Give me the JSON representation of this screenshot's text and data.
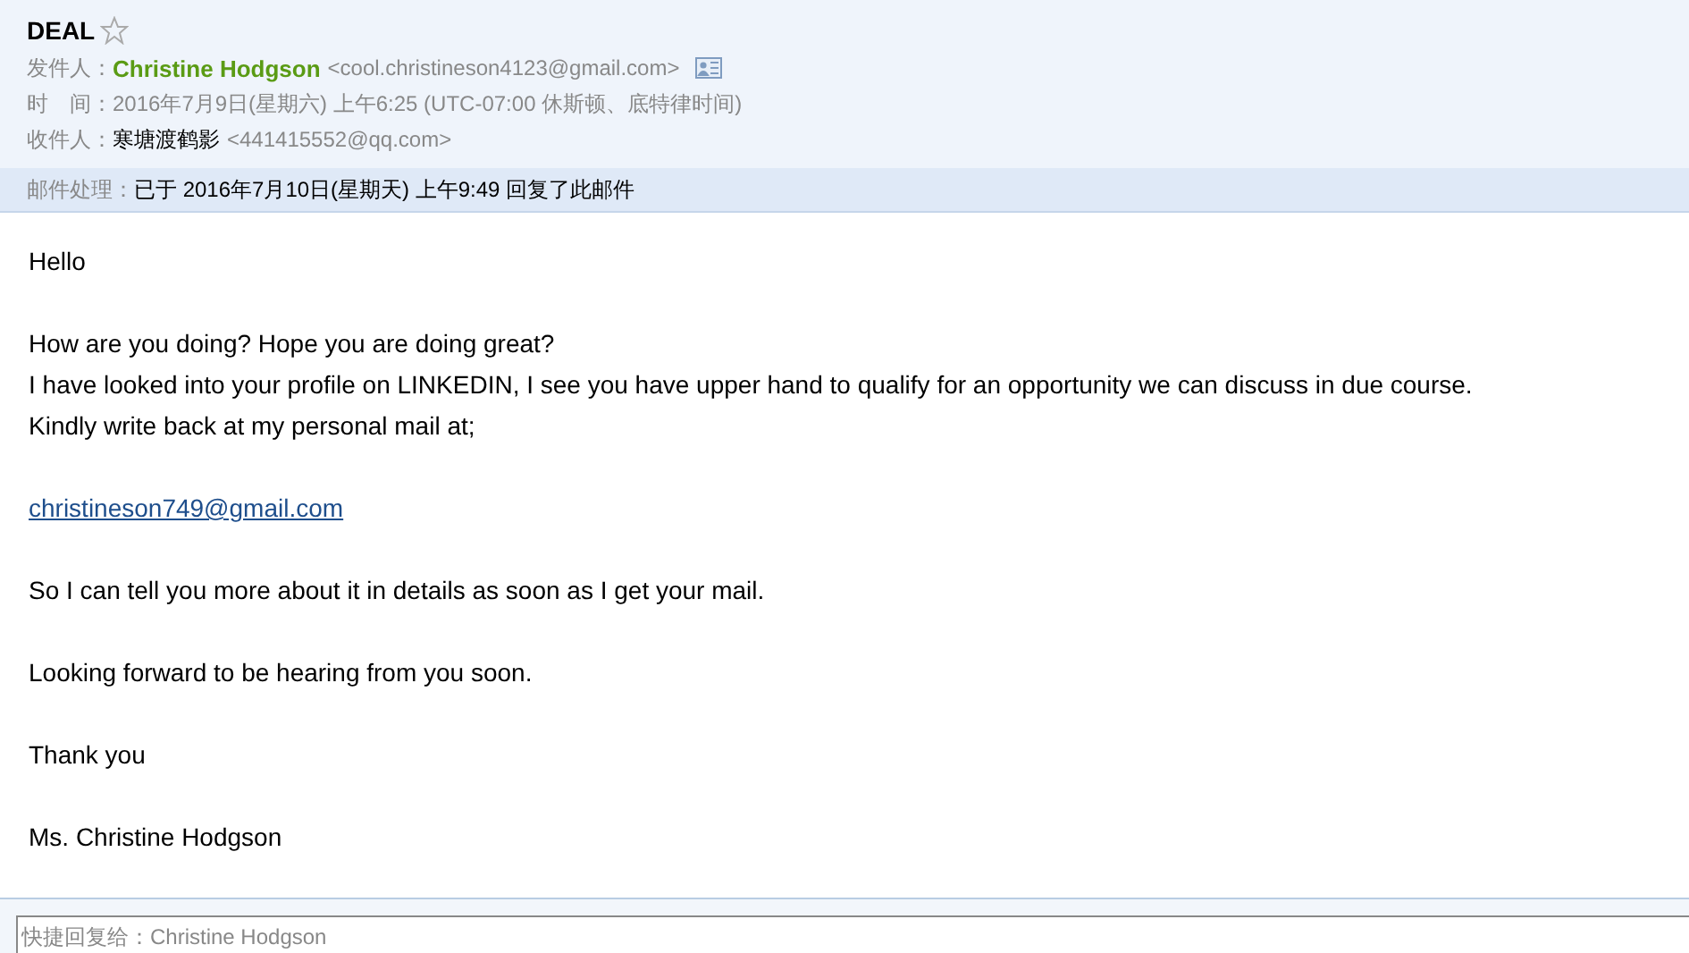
{
  "subject": "DEAL",
  "starred": false,
  "header": [
    {
      "label": "发件人：",
      "name": "Christine Hodgson",
      "address": "<cool.christineson4123@gmail.com>",
      "kind": "sender"
    },
    {
      "label": "时　间：",
      "value": "2016年7月9日(星期六) 上午6:25 (UTC-07:00 休斯顿、底特律时间)",
      "kind": "time"
    },
    {
      "label": "收件人：",
      "name": "寒塘渡鹤影",
      "address": "<441415552@qq.com>",
      "kind": "recipient"
    }
  ],
  "status": {
    "label": "邮件处理：",
    "value": "已于 2016年7月10日(星期天) 上午9:49 回复了此邮件"
  },
  "body": [
    {
      "kind": "text",
      "lines": [
        "Hello"
      ]
    },
    {
      "kind": "text",
      "lines": [
        "How are you doing? Hope you are doing great?",
        "I have looked into your profile on LINKEDIN, I see you have upper hand to qualify for an opportunity we can discuss in due course.",
        "Kindly write back at my personal mail at;"
      ]
    },
    {
      "kind": "link",
      "lines": [
        "christineson749@gmail.com"
      ]
    },
    {
      "kind": "text",
      "lines": [
        "So I can tell you more about it in details as soon as I get your mail."
      ]
    },
    {
      "kind": "text",
      "lines": [
        "Looking forward to be hearing from you soon."
      ]
    },
    {
      "kind": "text",
      "lines": [
        "Thank you"
      ]
    },
    {
      "kind": "text",
      "lines": [
        "Ms. Christine Hodgson"
      ]
    }
  ],
  "quick_reply": {
    "placeholder": "快捷回复给：Christine Hodgson"
  }
}
